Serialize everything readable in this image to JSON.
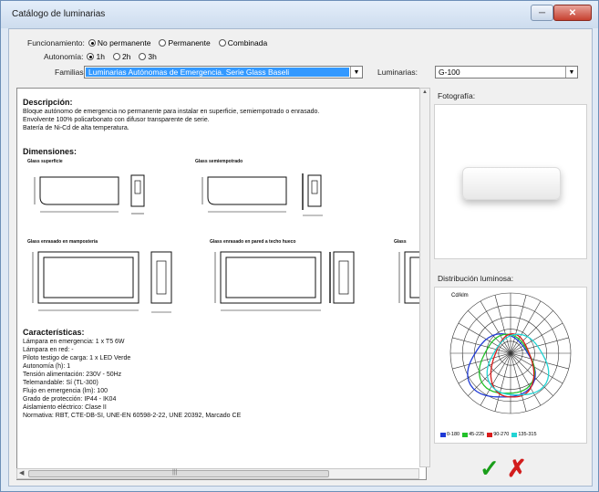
{
  "window": {
    "title": "Catálogo de luminarias"
  },
  "controls": {
    "funcionamiento_label": "Funcionamiento:",
    "funcionamiento_options": [
      "No permanente",
      "Permanente",
      "Combinada"
    ],
    "autonomia_label": "Autonomía:",
    "autonomia_options": [
      "1h",
      "2h",
      "3h"
    ],
    "familias_label": "Familias:",
    "familias_value": "Luminarias Autónomas de Emergencia. Serie Glass Baseli",
    "luminarias_label": "Luminarias:",
    "luminarias_value": "G-100"
  },
  "doc": {
    "descripcion_title": "Descripción:",
    "descripcion_lines": [
      "Bloque autónomo de emergencia no permanente para instalar en superficie, semiempotrado o enrasado.",
      "Envolvente 100% policarbonato con difusor transparente de serie.",
      "Batería de Ni-Cd de alta temperatura."
    ],
    "dimensiones_title": "Dimensiones:",
    "drawings": [
      "Glass superficie",
      "Glass semiempotrado",
      "Glass enrasado en mampostería",
      "Glass enrasado en pared a techo hueco",
      "Glass"
    ],
    "caracteristicas_title": "Características:",
    "caracteristicas_lines": [
      "Lámpara en emergencia: 1 x T5 6W",
      "Lámpara en red: -",
      "Piloto testigo de carga: 1 x LED Verde",
      "Autonomía (h): 1",
      "Tensión alimentación: 230V - 50Hz",
      "Telemandable: Sí (TL-300)",
      "Flujo en emergencia (lm): 100",
      "Grado de protección: IP44 - IK04",
      "Aislamiento eléctrico: Clase II",
      "Normativa: RBT, CTE-DB-SI, UNE-EN 60598-2-22, UNE 20392, Marcado CE"
    ]
  },
  "right": {
    "fotografia_label": "Fotografía:",
    "distribucion_label": "Distribución luminosa:",
    "polar_unit": "Cd/klm",
    "legend": [
      {
        "label": "0-180",
        "color": "#1f3ad6"
      },
      {
        "label": "45-225",
        "color": "#22c12a"
      },
      {
        "label": "90-270",
        "color": "#d91c1c"
      },
      {
        "label": "135-315",
        "color": "#22d4d4"
      }
    ]
  },
  "buttons": {
    "ok": "✓",
    "cancel": "✗"
  },
  "icons": {
    "minimize": "minimize-icon",
    "close": "close-icon"
  }
}
